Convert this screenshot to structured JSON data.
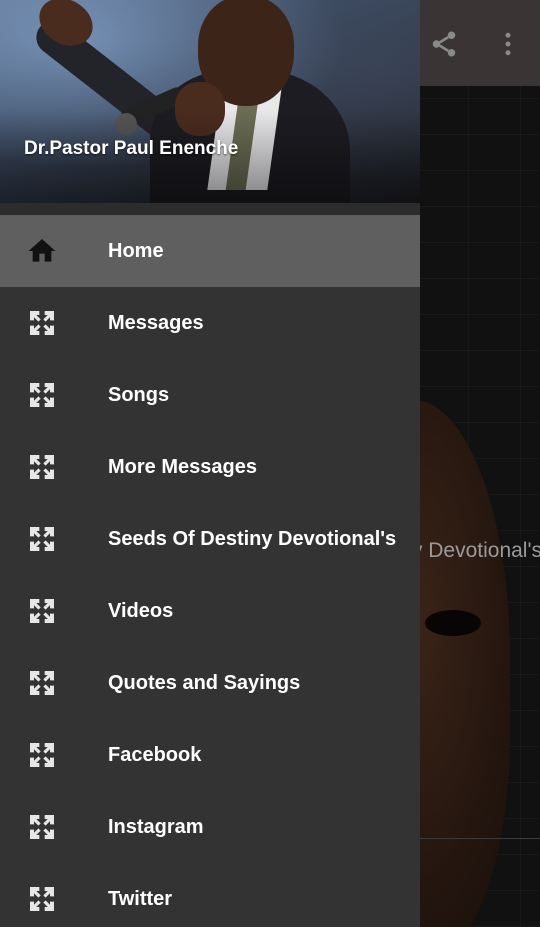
{
  "header": {
    "title": "Dr.Pastor Paul Enenche"
  },
  "toolbar": {
    "icons": [
      "share-icon",
      "more-vert-icon"
    ]
  },
  "background": {
    "partial_text": "Seeds Of Destiny Devotional's..."
  },
  "menu": {
    "items": [
      {
        "label": "Home",
        "icon": "home-icon",
        "active": true
      },
      {
        "label": "Messages",
        "icon": "fullscreen-exit-icon",
        "active": false
      },
      {
        "label": "Songs",
        "icon": "fullscreen-exit-icon",
        "active": false
      },
      {
        "label": "More Messages",
        "icon": "fullscreen-exit-icon",
        "active": false
      },
      {
        "label": "Seeds Of Destiny Devotional's",
        "icon": "fullscreen-exit-icon",
        "active": false
      },
      {
        "label": "Videos",
        "icon": "fullscreen-exit-icon",
        "active": false
      },
      {
        "label": "Quotes and Sayings",
        "icon": "fullscreen-exit-icon",
        "active": false
      },
      {
        "label": "Facebook",
        "icon": "fullscreen-exit-icon",
        "active": false
      },
      {
        "label": "Instagram",
        "icon": "fullscreen-exit-icon",
        "active": false
      },
      {
        "label": "Twitter",
        "icon": "fullscreen-exit-icon",
        "active": false
      }
    ]
  },
  "colors": {
    "drawer_bg": "#333333",
    "active_item_bg": "#5f5f5f",
    "toolbar_bg": "#3a3434",
    "menu_icon": "#e6e6e6",
    "text": "#ffffff"
  }
}
